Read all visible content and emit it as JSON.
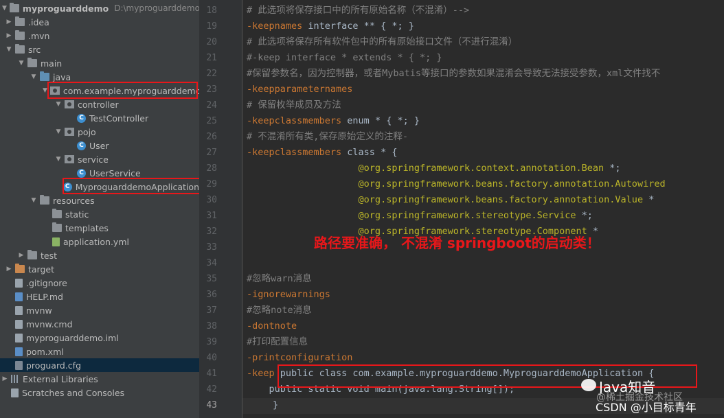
{
  "project": {
    "name": "myproguarddemo",
    "path": "D:\\myproguarddemo",
    "tree": [
      {
        "label": ".idea",
        "icon": "folder",
        "arrow": "right",
        "depth": 0
      },
      {
        "label": ".mvn",
        "icon": "folder",
        "arrow": "right",
        "depth": 0
      },
      {
        "label": "src",
        "icon": "folder",
        "arrow": "down",
        "depth": 0
      },
      {
        "label": "main",
        "icon": "folder",
        "arrow": "down",
        "depth": 1
      },
      {
        "label": "java",
        "icon": "folder-blue",
        "arrow": "down",
        "depth": 2
      },
      {
        "label": "com.example.myproguarddemo",
        "icon": "package",
        "arrow": "down",
        "depth": 3
      },
      {
        "label": "controller",
        "icon": "package",
        "arrow": "down",
        "depth": 4
      },
      {
        "label": "TestController",
        "icon": "class",
        "arrow": "",
        "depth": 5
      },
      {
        "label": "pojo",
        "icon": "package",
        "arrow": "down",
        "depth": 4
      },
      {
        "label": "User",
        "icon": "class",
        "arrow": "",
        "depth": 5
      },
      {
        "label": "service",
        "icon": "package",
        "arrow": "down",
        "depth": 4
      },
      {
        "label": "UserService",
        "icon": "class",
        "arrow": "",
        "depth": 5
      },
      {
        "label": "MyproguarddemoApplication",
        "icon": "class",
        "arrow": "",
        "depth": 4
      },
      {
        "label": "resources",
        "icon": "folder",
        "arrow": "down",
        "depth": 2
      },
      {
        "label": "static",
        "icon": "folder",
        "arrow": "",
        "depth": 3
      },
      {
        "label": "templates",
        "icon": "folder",
        "arrow": "",
        "depth": 3
      },
      {
        "label": "application.yml",
        "icon": "file-yml",
        "arrow": "",
        "depth": 3
      },
      {
        "label": "test",
        "icon": "folder",
        "arrow": "right",
        "depth": 1
      },
      {
        "label": "target",
        "icon": "folder-orange",
        "arrow": "right",
        "depth": 0
      },
      {
        "label": ".gitignore",
        "icon": "file",
        "arrow": "",
        "depth": 0
      },
      {
        "label": "HELP.md",
        "icon": "file-md",
        "arrow": "",
        "depth": 0
      },
      {
        "label": "mvnw",
        "icon": "file",
        "arrow": "",
        "depth": 0
      },
      {
        "label": "mvnw.cmd",
        "icon": "file",
        "arrow": "",
        "depth": 0
      },
      {
        "label": "myproguarddemo.iml",
        "icon": "file",
        "arrow": "",
        "depth": 0
      },
      {
        "label": "pom.xml",
        "icon": "file-xml",
        "arrow": "",
        "depth": 0
      },
      {
        "label": "proguard.cfg",
        "icon": "file-cfg",
        "arrow": "",
        "depth": 0,
        "selected": true
      },
      {
        "label": "External Libraries",
        "icon": "libraries",
        "arrow": "right",
        "depth": -1
      },
      {
        "label": "Scratches and Consoles",
        "icon": "scratches",
        "arrow": "",
        "depth": -1
      }
    ]
  },
  "editor": {
    "lines": [
      {
        "n": "18",
        "text": "# 此选项将保存接口中的所有原始名称（不混淆）-->",
        "style": "cm"
      },
      {
        "n": "19",
        "parts": [
          {
            "t": "-keepnames",
            "c": "kw"
          },
          {
            "t": " interface ** { *; }",
            "c": ""
          }
        ]
      },
      {
        "n": "20",
        "text": "# 此选项将保存所有软件包中的所有原始接口文件（不进行混淆）",
        "style": "cm"
      },
      {
        "n": "21",
        "text": "#-keep interface * extends * { *; }",
        "style": "cm"
      },
      {
        "n": "22",
        "text": "#保留参数名，因为控制器，或者Mybatis等接口的参数如果混淆会导致无法接受参数，xml文件找不",
        "style": "cm"
      },
      {
        "n": "23",
        "parts": [
          {
            "t": "-keepparameternames",
            "c": "kw"
          }
        ]
      },
      {
        "n": "24",
        "text": "# 保留枚举成员及方法",
        "style": "cm"
      },
      {
        "n": "25",
        "parts": [
          {
            "t": "-keepclassmembers",
            "c": "kw"
          },
          {
            "t": " enum * { *; }",
            "c": ""
          }
        ]
      },
      {
        "n": "26",
        "text": "# 不混淆所有类,保存原始定义的注释-",
        "style": "cm"
      },
      {
        "n": "27",
        "parts": [
          {
            "t": "-keepclassmembers",
            "c": "kw"
          },
          {
            "t": " class * {",
            "c": ""
          }
        ]
      },
      {
        "n": "28",
        "parts": [
          {
            "t": "                    @org.springframework.context.annotation.Bean",
            "c": "an"
          },
          {
            "t": " *;",
            "c": ""
          }
        ]
      },
      {
        "n": "29",
        "parts": [
          {
            "t": "                    @org.springframework.beans.factory.annotation.Autowired",
            "c": "an"
          }
        ]
      },
      {
        "n": "30",
        "parts": [
          {
            "t": "                    @org.springframework.beans.factory.annotation.Value",
            "c": "an"
          },
          {
            "t": " *",
            "c": ""
          }
        ]
      },
      {
        "n": "31",
        "parts": [
          {
            "t": "                    @org.springframework.stereotype.Service",
            "c": "an"
          },
          {
            "t": " *;",
            "c": ""
          }
        ]
      },
      {
        "n": "32",
        "parts": [
          {
            "t": "                    @org.springframework.stereotype.Component",
            "c": "an"
          },
          {
            "t": " *",
            "c": ""
          }
        ]
      },
      {
        "n": "33",
        "text": "",
        "style": ""
      },
      {
        "n": "34",
        "text": "",
        "style": ""
      },
      {
        "n": "35",
        "text": "#忽略warn消息",
        "style": "cm"
      },
      {
        "n": "36",
        "parts": [
          {
            "t": "-ignorewarnings",
            "c": "kw"
          }
        ]
      },
      {
        "n": "37",
        "text": "#忽略note消息",
        "style": "cm"
      },
      {
        "n": "38",
        "parts": [
          {
            "t": "-dontnote",
            "c": "kw"
          }
        ]
      },
      {
        "n": "39",
        "text": "#打印配置信息",
        "style": "cm"
      },
      {
        "n": "40",
        "parts": [
          {
            "t": "-printconfiguration",
            "c": "kw"
          }
        ]
      },
      {
        "n": "41",
        "parts": [
          {
            "t": "-keep",
            "c": "kw"
          },
          {
            "t": " public class com.example.myproguarddemo.MyproguarddemoApplication {",
            "c": ""
          }
        ]
      },
      {
        "n": "42",
        "parts": [
          {
            "t": "    public static void main(java.lang.String[]);",
            "c": ""
          }
        ]
      },
      {
        "n": "43",
        "text": "}",
        "style": ""
      }
    ],
    "annotation": "路径要准确， 不混淆 springboot的启动类！"
  },
  "watermark": {
    "brand": "Java知音",
    "faint": "@稀土掘金技术社区",
    "csdn": "CSDN @小目标青年"
  },
  "colors": {
    "annotation_red": "#e8171a",
    "keyword": "#cc7832",
    "comment": "#808080",
    "annotation_code": "#bbb529"
  }
}
